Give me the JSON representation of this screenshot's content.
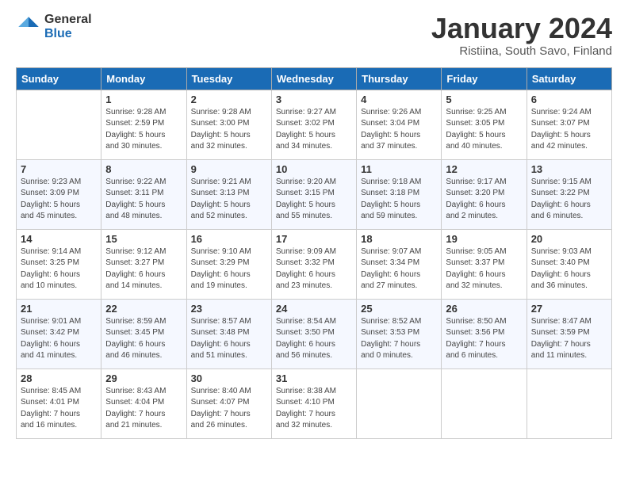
{
  "logo": {
    "general": "General",
    "blue": "Blue"
  },
  "title": "January 2024",
  "subtitle": "Ristiina, South Savo, Finland",
  "weekdays": [
    "Sunday",
    "Monday",
    "Tuesday",
    "Wednesday",
    "Thursday",
    "Friday",
    "Saturday"
  ],
  "weeks": [
    [
      {
        "day": "",
        "info": ""
      },
      {
        "day": "1",
        "info": "Sunrise: 9:28 AM\nSunset: 2:59 PM\nDaylight: 5 hours\nand 30 minutes."
      },
      {
        "day": "2",
        "info": "Sunrise: 9:28 AM\nSunset: 3:00 PM\nDaylight: 5 hours\nand 32 minutes."
      },
      {
        "day": "3",
        "info": "Sunrise: 9:27 AM\nSunset: 3:02 PM\nDaylight: 5 hours\nand 34 minutes."
      },
      {
        "day": "4",
        "info": "Sunrise: 9:26 AM\nSunset: 3:04 PM\nDaylight: 5 hours\nand 37 minutes."
      },
      {
        "day": "5",
        "info": "Sunrise: 9:25 AM\nSunset: 3:05 PM\nDaylight: 5 hours\nand 40 minutes."
      },
      {
        "day": "6",
        "info": "Sunrise: 9:24 AM\nSunset: 3:07 PM\nDaylight: 5 hours\nand 42 minutes."
      }
    ],
    [
      {
        "day": "7",
        "info": "Sunrise: 9:23 AM\nSunset: 3:09 PM\nDaylight: 5 hours\nand 45 minutes."
      },
      {
        "day": "8",
        "info": "Sunrise: 9:22 AM\nSunset: 3:11 PM\nDaylight: 5 hours\nand 48 minutes."
      },
      {
        "day": "9",
        "info": "Sunrise: 9:21 AM\nSunset: 3:13 PM\nDaylight: 5 hours\nand 52 minutes."
      },
      {
        "day": "10",
        "info": "Sunrise: 9:20 AM\nSunset: 3:15 PM\nDaylight: 5 hours\nand 55 minutes."
      },
      {
        "day": "11",
        "info": "Sunrise: 9:18 AM\nSunset: 3:18 PM\nDaylight: 5 hours\nand 59 minutes."
      },
      {
        "day": "12",
        "info": "Sunrise: 9:17 AM\nSunset: 3:20 PM\nDaylight: 6 hours\nand 2 minutes."
      },
      {
        "day": "13",
        "info": "Sunrise: 9:15 AM\nSunset: 3:22 PM\nDaylight: 6 hours\nand 6 minutes."
      }
    ],
    [
      {
        "day": "14",
        "info": "Sunrise: 9:14 AM\nSunset: 3:25 PM\nDaylight: 6 hours\nand 10 minutes."
      },
      {
        "day": "15",
        "info": "Sunrise: 9:12 AM\nSunset: 3:27 PM\nDaylight: 6 hours\nand 14 minutes."
      },
      {
        "day": "16",
        "info": "Sunrise: 9:10 AM\nSunset: 3:29 PM\nDaylight: 6 hours\nand 19 minutes."
      },
      {
        "day": "17",
        "info": "Sunrise: 9:09 AM\nSunset: 3:32 PM\nDaylight: 6 hours\nand 23 minutes."
      },
      {
        "day": "18",
        "info": "Sunrise: 9:07 AM\nSunset: 3:34 PM\nDaylight: 6 hours\nand 27 minutes."
      },
      {
        "day": "19",
        "info": "Sunrise: 9:05 AM\nSunset: 3:37 PM\nDaylight: 6 hours\nand 32 minutes."
      },
      {
        "day": "20",
        "info": "Sunrise: 9:03 AM\nSunset: 3:40 PM\nDaylight: 6 hours\nand 36 minutes."
      }
    ],
    [
      {
        "day": "21",
        "info": "Sunrise: 9:01 AM\nSunset: 3:42 PM\nDaylight: 6 hours\nand 41 minutes."
      },
      {
        "day": "22",
        "info": "Sunrise: 8:59 AM\nSunset: 3:45 PM\nDaylight: 6 hours\nand 46 minutes."
      },
      {
        "day": "23",
        "info": "Sunrise: 8:57 AM\nSunset: 3:48 PM\nDaylight: 6 hours\nand 51 minutes."
      },
      {
        "day": "24",
        "info": "Sunrise: 8:54 AM\nSunset: 3:50 PM\nDaylight: 6 hours\nand 56 minutes."
      },
      {
        "day": "25",
        "info": "Sunrise: 8:52 AM\nSunset: 3:53 PM\nDaylight: 7 hours\nand 0 minutes."
      },
      {
        "day": "26",
        "info": "Sunrise: 8:50 AM\nSunset: 3:56 PM\nDaylight: 7 hours\nand 6 minutes."
      },
      {
        "day": "27",
        "info": "Sunrise: 8:47 AM\nSunset: 3:59 PM\nDaylight: 7 hours\nand 11 minutes."
      }
    ],
    [
      {
        "day": "28",
        "info": "Sunrise: 8:45 AM\nSunset: 4:01 PM\nDaylight: 7 hours\nand 16 minutes."
      },
      {
        "day": "29",
        "info": "Sunrise: 8:43 AM\nSunset: 4:04 PM\nDaylight: 7 hours\nand 21 minutes."
      },
      {
        "day": "30",
        "info": "Sunrise: 8:40 AM\nSunset: 4:07 PM\nDaylight: 7 hours\nand 26 minutes."
      },
      {
        "day": "31",
        "info": "Sunrise: 8:38 AM\nSunset: 4:10 PM\nDaylight: 7 hours\nand 32 minutes."
      },
      {
        "day": "",
        "info": ""
      },
      {
        "day": "",
        "info": ""
      },
      {
        "day": "",
        "info": ""
      }
    ]
  ]
}
